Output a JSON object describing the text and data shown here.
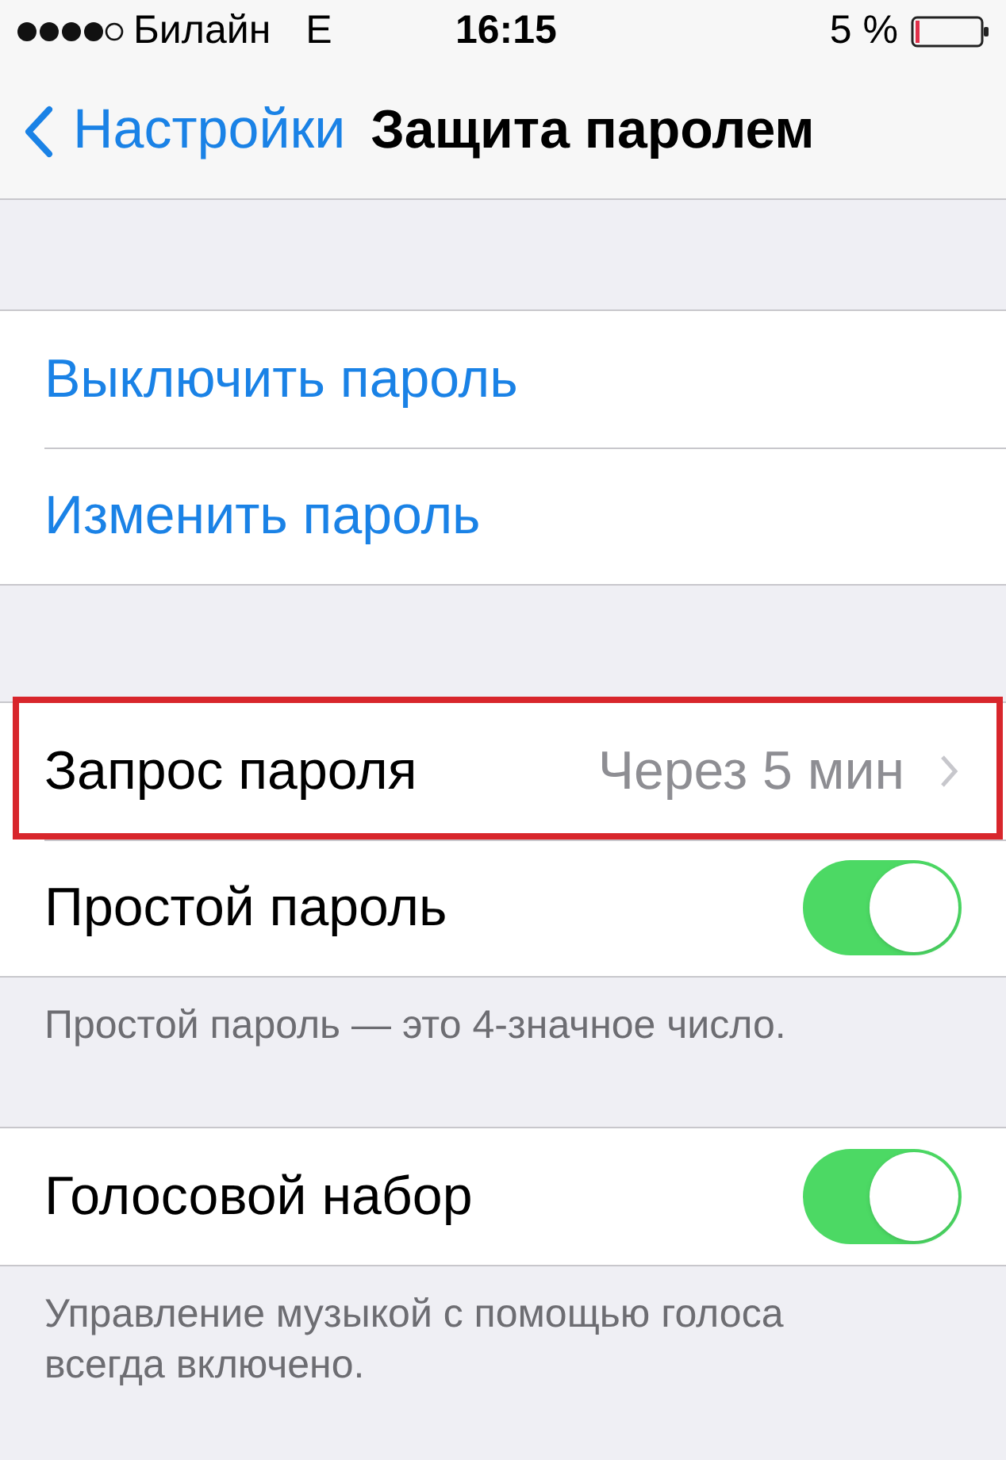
{
  "status_bar": {
    "carrier": "Билайн",
    "network": "E",
    "time": "16:15",
    "battery": "5 %"
  },
  "nav": {
    "back": "Настройки",
    "title": "Защита паролем"
  },
  "sections": [
    {
      "rows": [
        {
          "kind": "action",
          "label": "Выключить пароль",
          "highlighted": false
        },
        {
          "kind": "action",
          "label": "Изменить пароль",
          "highlighted": false
        }
      ]
    },
    {
      "rows": [
        {
          "kind": "value",
          "label": "Запрос пароля",
          "value": "Через 5 мин",
          "highlighted": true
        },
        {
          "kind": "toggle",
          "label": "Простой пароль",
          "on": true,
          "highlighted": false
        }
      ],
      "footer": "Простой пароль — это 4-значное число."
    },
    {
      "rows": [
        {
          "kind": "toggle",
          "label": "Голосовой набор",
          "on": true,
          "highlighted": false
        }
      ],
      "footer": "Управление музыкой с помощью голоса всегда включено."
    }
  ]
}
